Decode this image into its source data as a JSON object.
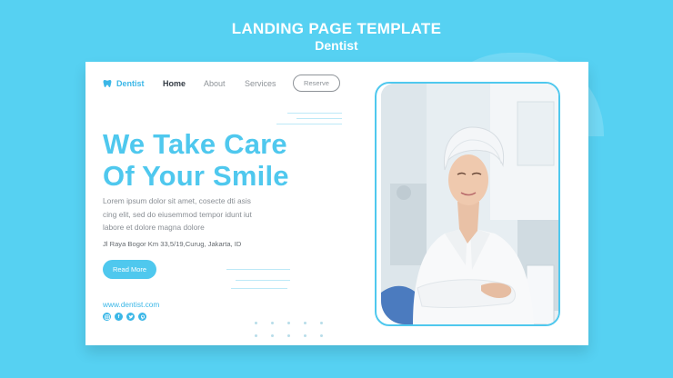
{
  "banner": {
    "title": "LANDING PAGE TEMPLATE",
    "subtitle": "Dentist"
  },
  "nav": {
    "logo_text": "Dentist",
    "links": [
      "Home",
      "About",
      "Services"
    ],
    "reserve_label": "Reserve"
  },
  "hero": {
    "headline_line1": "We Take Care",
    "headline_line2": "Of Your Smile",
    "body_line1": "Lorem ipsum dolor sit amet, cosecte dti asis",
    "body_line2": "cing elit, sed do eiusemmod tempor idunt iut",
    "body_line3": "labore et dolore magna dolore",
    "address": "Jl Raya Bogor Km 33,5/19,Curug, Jakarta, ID",
    "read_more_label": "Read More",
    "website": "www.dentist.com"
  },
  "social_icons": [
    "instagram-icon",
    "facebook-icon",
    "twitter-icon",
    "pinterest-icon"
  ],
  "colors": {
    "background": "#56d1f2",
    "accent": "#4fc8ee",
    "card": "#ffffff",
    "nav_active": "#333b44"
  }
}
